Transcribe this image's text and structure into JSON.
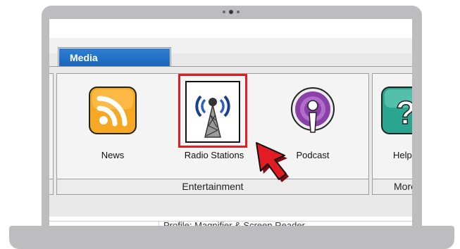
{
  "tab": {
    "label": "Media"
  },
  "ribbon": {
    "items": [
      {
        "label": "News",
        "icon": "rss-feed-icon"
      },
      {
        "label": "Radio Stations",
        "icon": "radio-tower-icon"
      },
      {
        "label": "Podcast",
        "icon": "podcast-icon"
      },
      {
        "label": "Help",
        "icon": "help-icon"
      }
    ],
    "groups": [
      {
        "label": "Entertainment"
      },
      {
        "label": "More"
      }
    ]
  },
  "bottom": {
    "profile_text": "Profile: Magnifier & Screen Reader"
  },
  "colors": {
    "tab_blue": "#1f6fc4",
    "highlight_red": "#e21c22",
    "rss_orange": "#f7a823",
    "podcast_purple": "#8b3fa8",
    "help_teal": "#2aa58f"
  }
}
